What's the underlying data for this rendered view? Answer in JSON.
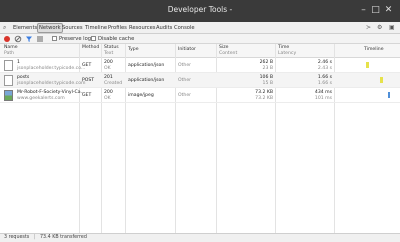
{
  "window": {
    "title": "Developer Tools -"
  },
  "tabs": [
    {
      "label": "Elements"
    },
    {
      "label": "Network"
    },
    {
      "label": "Sources"
    },
    {
      "label": "Timeline"
    },
    {
      "label": "Profiles"
    },
    {
      "label": "Resources"
    },
    {
      "label": "Audits"
    },
    {
      "label": "Console"
    }
  ],
  "toolbar": {
    "preserve_log": "Preserve log",
    "disable_cache": "Disable cache"
  },
  "columns": {
    "name": "Name",
    "name_sub": "Path",
    "method": "Method",
    "status": "Status",
    "status_sub": "Text",
    "type": "Type",
    "initiator": "Initiator",
    "size": "Size",
    "size_sub": "Content",
    "time": "Time",
    "time_sub": "Latency",
    "timeline": "Timeline"
  },
  "rows": [
    {
      "name": "1",
      "path": "jsonplaceholder.typicode.co...",
      "method": "GET",
      "status": "200",
      "status_text": "OK",
      "type": "application/json",
      "initiator": "Other",
      "size": "262 B",
      "content": "23 B",
      "time": "2.46 s",
      "latency": "2.43 s",
      "icon": "document-icon"
    },
    {
      "name": "posts",
      "path": "jsonplaceholder.typicode.com",
      "method": "POST",
      "status": "201",
      "status_text": "Created",
      "type": "application/json",
      "initiator": "Other",
      "size": "106 B",
      "content": "15 B",
      "time": "1.66 s",
      "latency": "1.66 s",
      "icon": "document-icon"
    },
    {
      "name": "Mr-Robot-F-Society-Vinyl-Ca...",
      "path": "www.geekalerts.com",
      "method": "GET",
      "status": "200",
      "status_text": "OK",
      "type": "image/jpeg",
      "initiator": "Other",
      "size": "73.2 KB",
      "content": "73.2 KB",
      "time": "434 ms",
      "latency": "101 ms",
      "icon": "image-icon"
    }
  ],
  "statusbar": {
    "requests": "3 requests",
    "transferred": "73.4 KB transferred"
  },
  "colors": {
    "titlebar": "#3a3a3a",
    "record": "#d9342b",
    "timeline_wait": "#e6e24a",
    "timeline_recv": "#4f8fd8"
  }
}
